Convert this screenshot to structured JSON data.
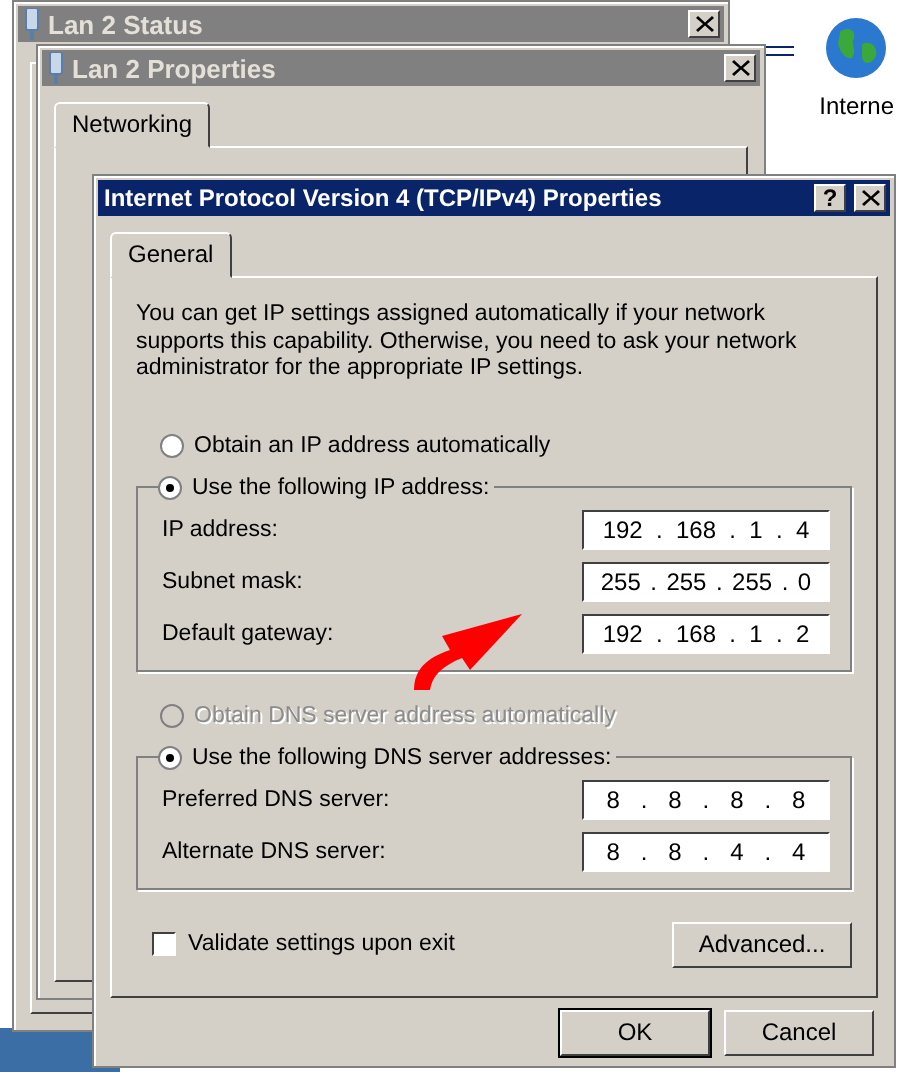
{
  "desktop": {
    "icon_label": "Interne"
  },
  "background_windows": [
    {
      "title": "Lan 2 Status"
    },
    {
      "title": "Lan 2 Properties",
      "tab": "Networking"
    }
  ],
  "dialog": {
    "title": "Internet Protocol Version 4 (TCP/IPv4) Properties",
    "help": "?",
    "tabs": [
      {
        "label": "General",
        "selected": true
      }
    ],
    "intro": "You can get IP settings assigned automatically if your network supports this capability. Otherwise, you need to ask your network administrator for the appropriate IP settings.",
    "ip_options": [
      {
        "label": "Obtain an IP address automatically",
        "selected": false,
        "disabled": false
      },
      {
        "label": "Use the following IP address:",
        "selected": true,
        "disabled": false
      }
    ],
    "ip_fields": [
      {
        "label": "IP address:",
        "value": [
          "192",
          ".",
          "168",
          ".",
          "1",
          ".",
          "4"
        ]
      },
      {
        "label": "Subnet mask:",
        "value": [
          "255",
          ".",
          "255",
          ".",
          "255",
          ".",
          "0"
        ]
      },
      {
        "label": "Default gateway:",
        "value": [
          "192",
          ".",
          "168",
          ".",
          "1",
          ".",
          "2"
        ]
      }
    ],
    "dns_options": [
      {
        "label": "Obtain DNS server address automatically",
        "selected": false,
        "disabled": true
      },
      {
        "label": "Use the following DNS server addresses:",
        "selected": true,
        "disabled": false
      }
    ],
    "dns_fields": [
      {
        "label": "Preferred DNS server:",
        "value": [
          "8",
          ".",
          "8",
          ".",
          "8",
          ".",
          "8"
        ]
      },
      {
        "label": "Alternate DNS server:",
        "value": [
          "8",
          ".",
          "8",
          ".",
          "4",
          ".",
          "4"
        ]
      }
    ],
    "validate": {
      "label": "Validate settings upon exit",
      "checked": false
    },
    "advanced_button": "Advanced...",
    "buttons": [
      "OK",
      "Cancel"
    ]
  }
}
